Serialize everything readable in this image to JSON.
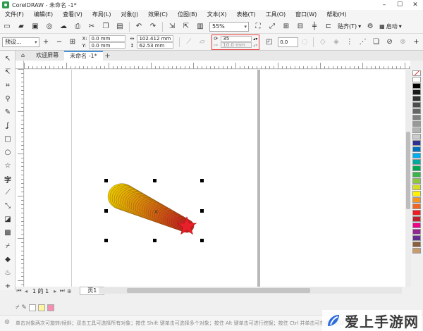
{
  "window": {
    "title": "CorelDRAW - 未命名 -1*"
  },
  "menu": {
    "items": [
      "文件(F)",
      "编辑(E)",
      "查看(V)",
      "布局(L)",
      "对象(J)",
      "效果(C)",
      "位图(B)",
      "文本(X)",
      "表格(T)",
      "工具(O)",
      "窗口(W)",
      "帮助(H)"
    ]
  },
  "toolbar": {
    "zoom": "55%",
    "snap_label": "贴齐(T)",
    "launch_label": "启动"
  },
  "property_bar": {
    "preset": "预设...",
    "x_label": "X:",
    "x_value": "0.0 mm",
    "y_label": "Y:",
    "y_value": "0.0 mm",
    "width_value": "102.412 mm",
    "height_value": "62.53 mm",
    "steps_value": "35",
    "spacing_value": "10.0 mm",
    "rotation_value": "0.0"
  },
  "tabs": [
    {
      "label": "欢迎屏幕"
    },
    {
      "label": "未命名 -1*"
    }
  ],
  "pager": {
    "page_of": "1  的  1",
    "page_tab": "页1"
  },
  "status": {
    "hint": "单击对象两次可旋转/倾斜；双击工具可选择所有对象；按住 Shift 键单击可选择多个对象；按住 Alt 键单击可进行挖掘；按住 Ctrl 并单击可在组中选择对象"
  },
  "watermark": {
    "text": "爱上手游网"
  },
  "colors": {
    "highlight": "#e53935",
    "star": "#e8202a",
    "blend_start": "#e8c800",
    "blend_end": "#c0261e"
  },
  "palette": [
    "#ffffff",
    "#000000",
    "#1a1a1a",
    "#333333",
    "#4d4d4d",
    "#666666",
    "#808080",
    "#999999",
    "#b3b3b3",
    "#cccccc",
    "#2e3192",
    "#0072bc",
    "#00aeef",
    "#00a99d",
    "#00a651",
    "#39b54a",
    "#8dc63f",
    "#d7df23",
    "#fff200",
    "#f7941d",
    "#f26522",
    "#ed1c24",
    "#be1e2d",
    "#ec008c",
    "#92278f",
    "#662d91",
    "#8b5e3c",
    "#c69c6d"
  ]
}
